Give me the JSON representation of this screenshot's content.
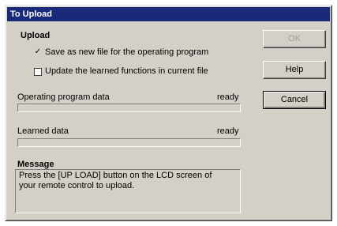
{
  "window": {
    "title": "To Upload"
  },
  "upload": {
    "heading": "Upload",
    "options": [
      {
        "label": "Save as new file for the operating program",
        "checked": true
      },
      {
        "label": "Update the learned functions in current file",
        "checked": false
      }
    ]
  },
  "operating": {
    "label": "Operating program data",
    "status": "ready"
  },
  "learned": {
    "label": "Learned data",
    "status": "ready"
  },
  "message": {
    "heading": "Message",
    "line1": "Press the [UP LOAD] button on the LCD screen of",
    "line2": "your remote control to upload."
  },
  "buttons": {
    "ok": "OK",
    "help": "Help",
    "cancel": "Cancel"
  },
  "icons": {
    "check_mark": "✓"
  }
}
